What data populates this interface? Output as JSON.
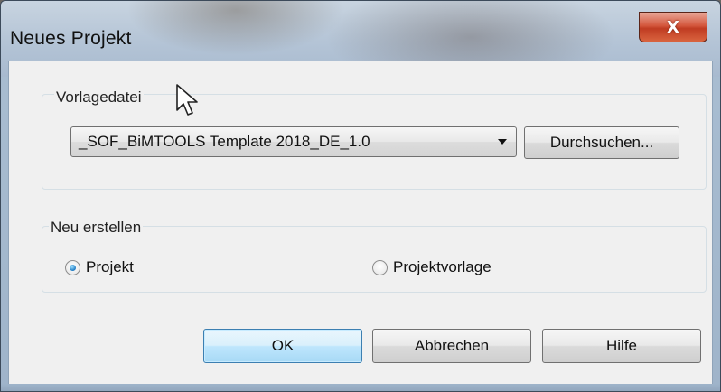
{
  "window": {
    "title": "Neues Projekt",
    "close_glyph": "X"
  },
  "template_group": {
    "legend": "Vorlagedatei",
    "selected_template": "_SOF_BiMTOOLS Template 2018_DE_1.0",
    "browse_label": "Durchsuchen..."
  },
  "create_group": {
    "legend": "Neu erstellen",
    "options": [
      {
        "label": "Projekt",
        "checked": true
      },
      {
        "label": "Projektvorlage",
        "checked": false
      }
    ]
  },
  "buttons": {
    "ok": "OK",
    "cancel": "Abbrechen",
    "help": "Hilfe"
  },
  "colors": {
    "accent_button_border": "#3c7fb1",
    "close_button": "#c03c22"
  },
  "icons": {
    "close": "close-icon",
    "dropdown": "chevron-down-icon",
    "cursor": "mouse-pointer-icon"
  }
}
